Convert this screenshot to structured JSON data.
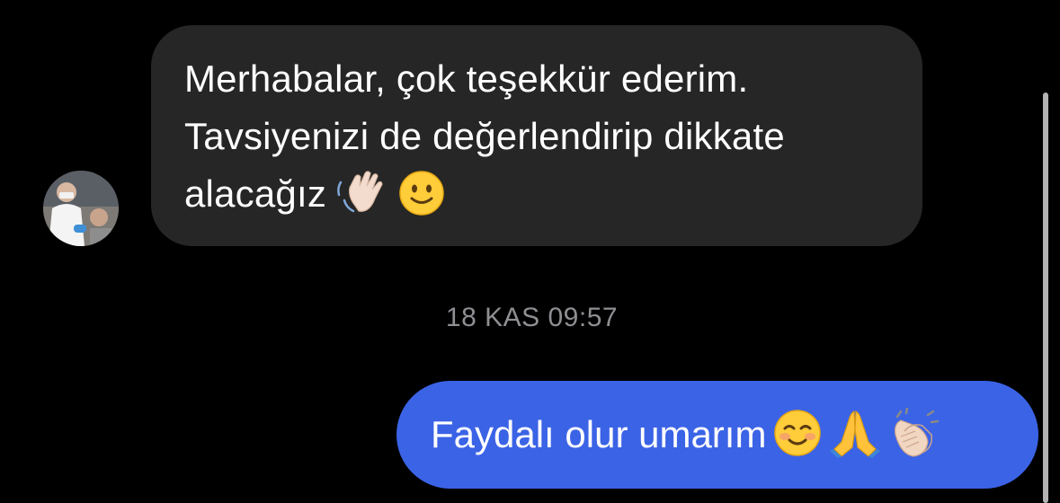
{
  "thread": {
    "incoming": {
      "sender_avatar": "avatar-photo-doctor",
      "lines": [
        "Merhabalar, çok teşekkür ederim.",
        "Tavsiyenizi de değerlendirip dikkate",
        "alacağız"
      ],
      "emojis": [
        "waving-hand-icon",
        "slightly-smiling-face-icon"
      ]
    },
    "timestamp": "18 KAS 09:57",
    "outgoing": {
      "text": "Faydalı olur umarım",
      "emojis": [
        "smiling-face-icon",
        "folded-hands-icon",
        "clapping-hands-icon"
      ]
    }
  },
  "colors": {
    "background": "#000000",
    "incoming_bubble": "#262626",
    "outgoing_bubble": "#3b63e6",
    "timestamp_text": "#8e8e93",
    "scrollbar": "#b3b3b3"
  }
}
